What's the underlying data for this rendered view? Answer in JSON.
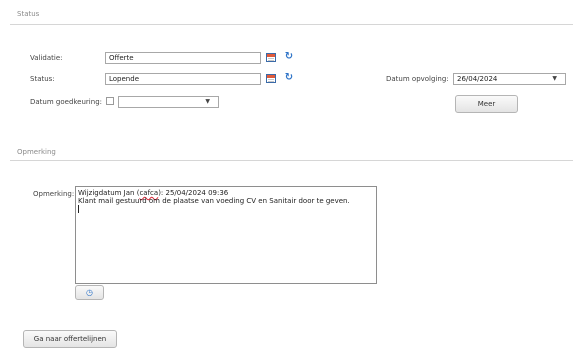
{
  "sections": {
    "status_title": "Status",
    "remark_title": "Opmerking"
  },
  "validation": {
    "label": "Validatie:",
    "value": "Offerte"
  },
  "status": {
    "label": "Status:",
    "value": "Lopende"
  },
  "approval_date": {
    "label": "Datum goedkeuring:",
    "value": ""
  },
  "follow_up": {
    "label": "Datum opvolging:",
    "value": "26/04/2024"
  },
  "buttons": {
    "more": "Meer",
    "go_to_quote_lines": "Ga naar offertelijnen"
  },
  "remark": {
    "label": "Opmerking:",
    "line1_prefix": "Wijzigdatum Jan (",
    "line1_user": "cafca",
    "line1_suffix": "): 25/04/2024 09:36",
    "line2": "Klant mail gestuurd om de plaatse van voeding CV en Sanitair door te geven."
  },
  "icons": {
    "calendar": "calendar-icon",
    "attach": "paperclip-icon",
    "dropdown": "chevron-down-icon",
    "clock": "clock-icon"
  }
}
